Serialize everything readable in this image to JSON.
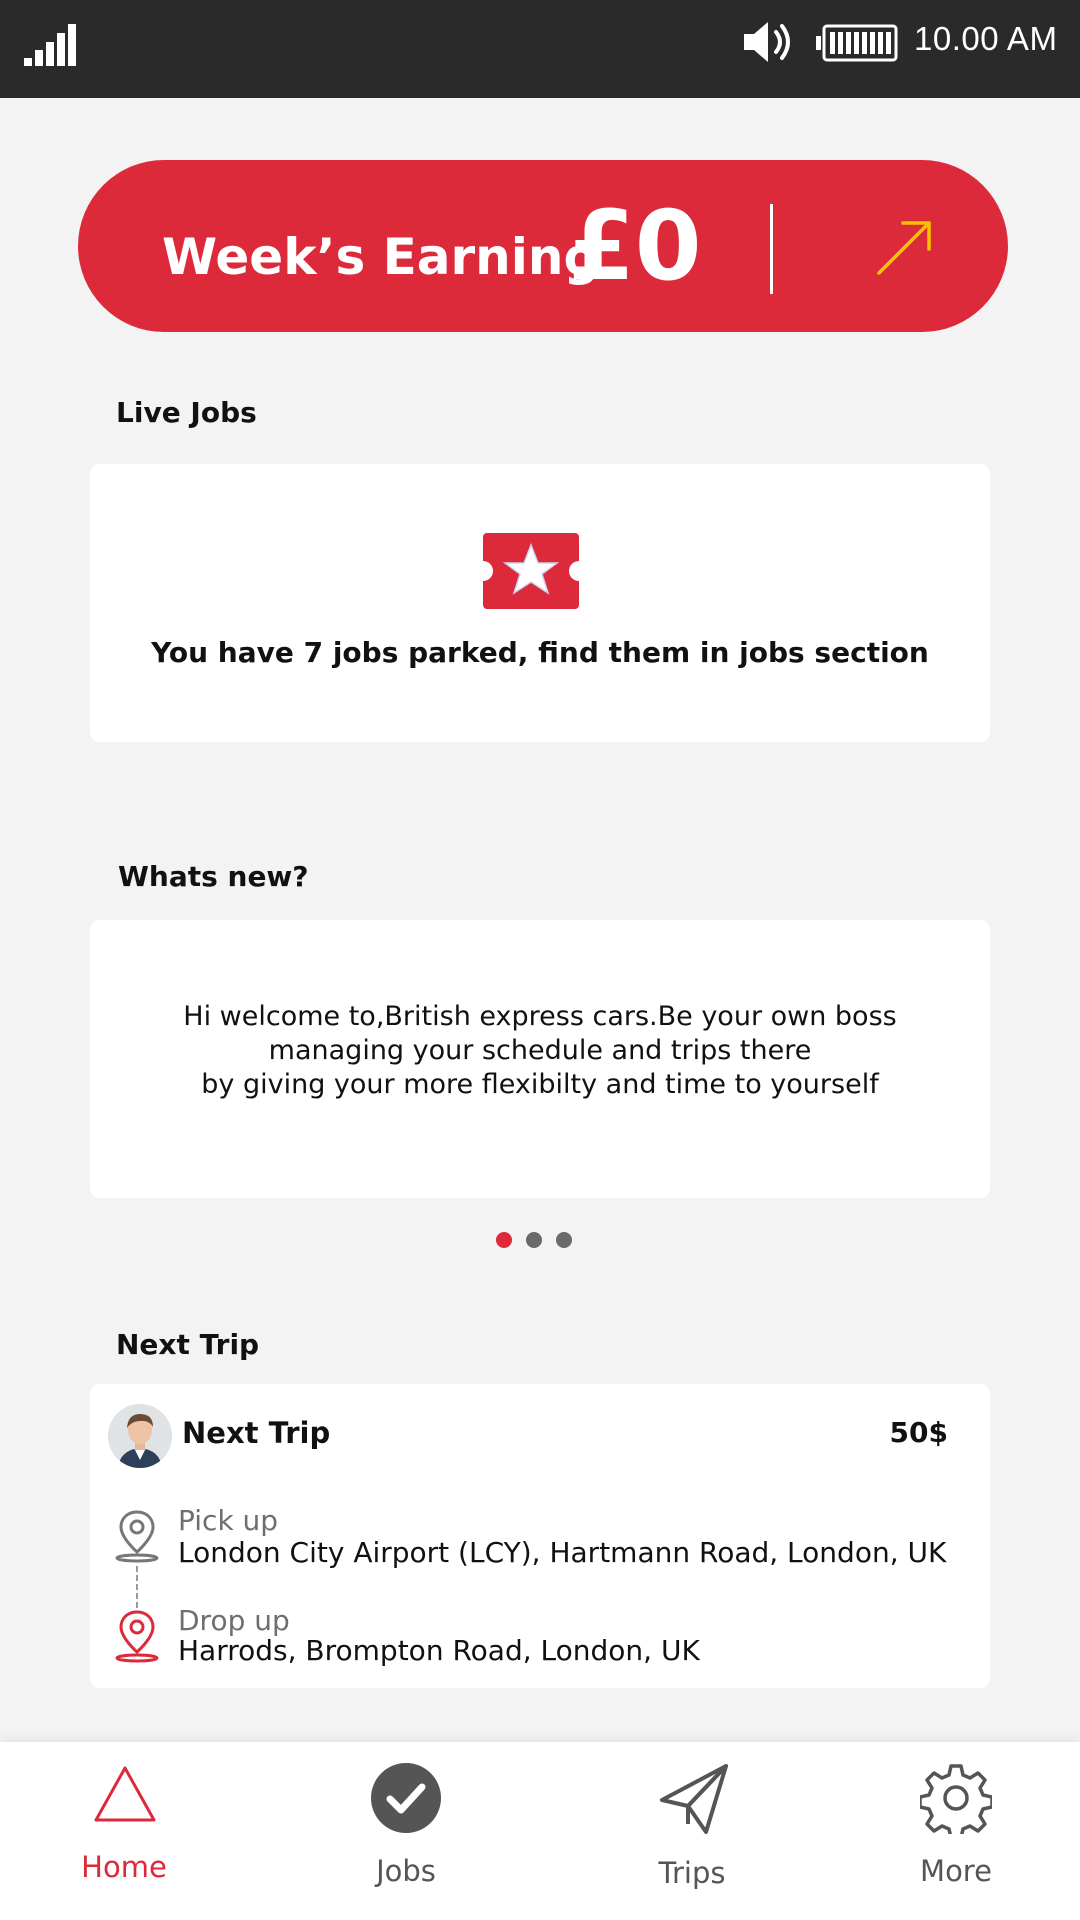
{
  "status_bar": {
    "time": "10.00 AM",
    "signal_icon": "signal-icon",
    "volume_icon": "speaker-icon",
    "battery_icon": "battery-icon"
  },
  "earning": {
    "label": "Week’s Earning",
    "amount": "£0",
    "arrow_icon": "arrow-up-right-icon",
    "arrow_color": "#f3c300",
    "background_color": "#dd2a3b"
  },
  "live_jobs": {
    "title": "Live Jobs",
    "icon": "ticket-star-icon",
    "message": "You have 7 jobs parked, find them in jobs section"
  },
  "whats_new": {
    "title": "Whats new?",
    "message": "Hi welcome to,British express cars.Be your own boss\nmanaging your schedule and trips there\nby giving your more flexibilty and time to yourself",
    "carousel_pages": 3,
    "carousel_active": 1
  },
  "next_trip": {
    "section_title": "Next Trip",
    "card_title": "Next Trip",
    "price": "50$",
    "pickup_label": "Pick up",
    "pickup_value": "London City Airport (LCY), Hartmann Road, London, UK",
    "drop_label": "Drop up",
    "drop_value": "Harrods, Brompton Road, London, UK"
  },
  "bottom_nav": {
    "items": [
      {
        "label": "Home",
        "icon": "triangle-icon",
        "active": true
      },
      {
        "label": "Jobs",
        "icon": "check-circle-icon",
        "active": false
      },
      {
        "label": "Trips",
        "icon": "paper-plane-icon",
        "active": false
      },
      {
        "label": "More",
        "icon": "gear-icon",
        "active": false
      }
    ]
  },
  "colors": {
    "accent": "#dd2a3b",
    "status_bar": "#2b2a2a",
    "background": "#f3f3f3"
  }
}
